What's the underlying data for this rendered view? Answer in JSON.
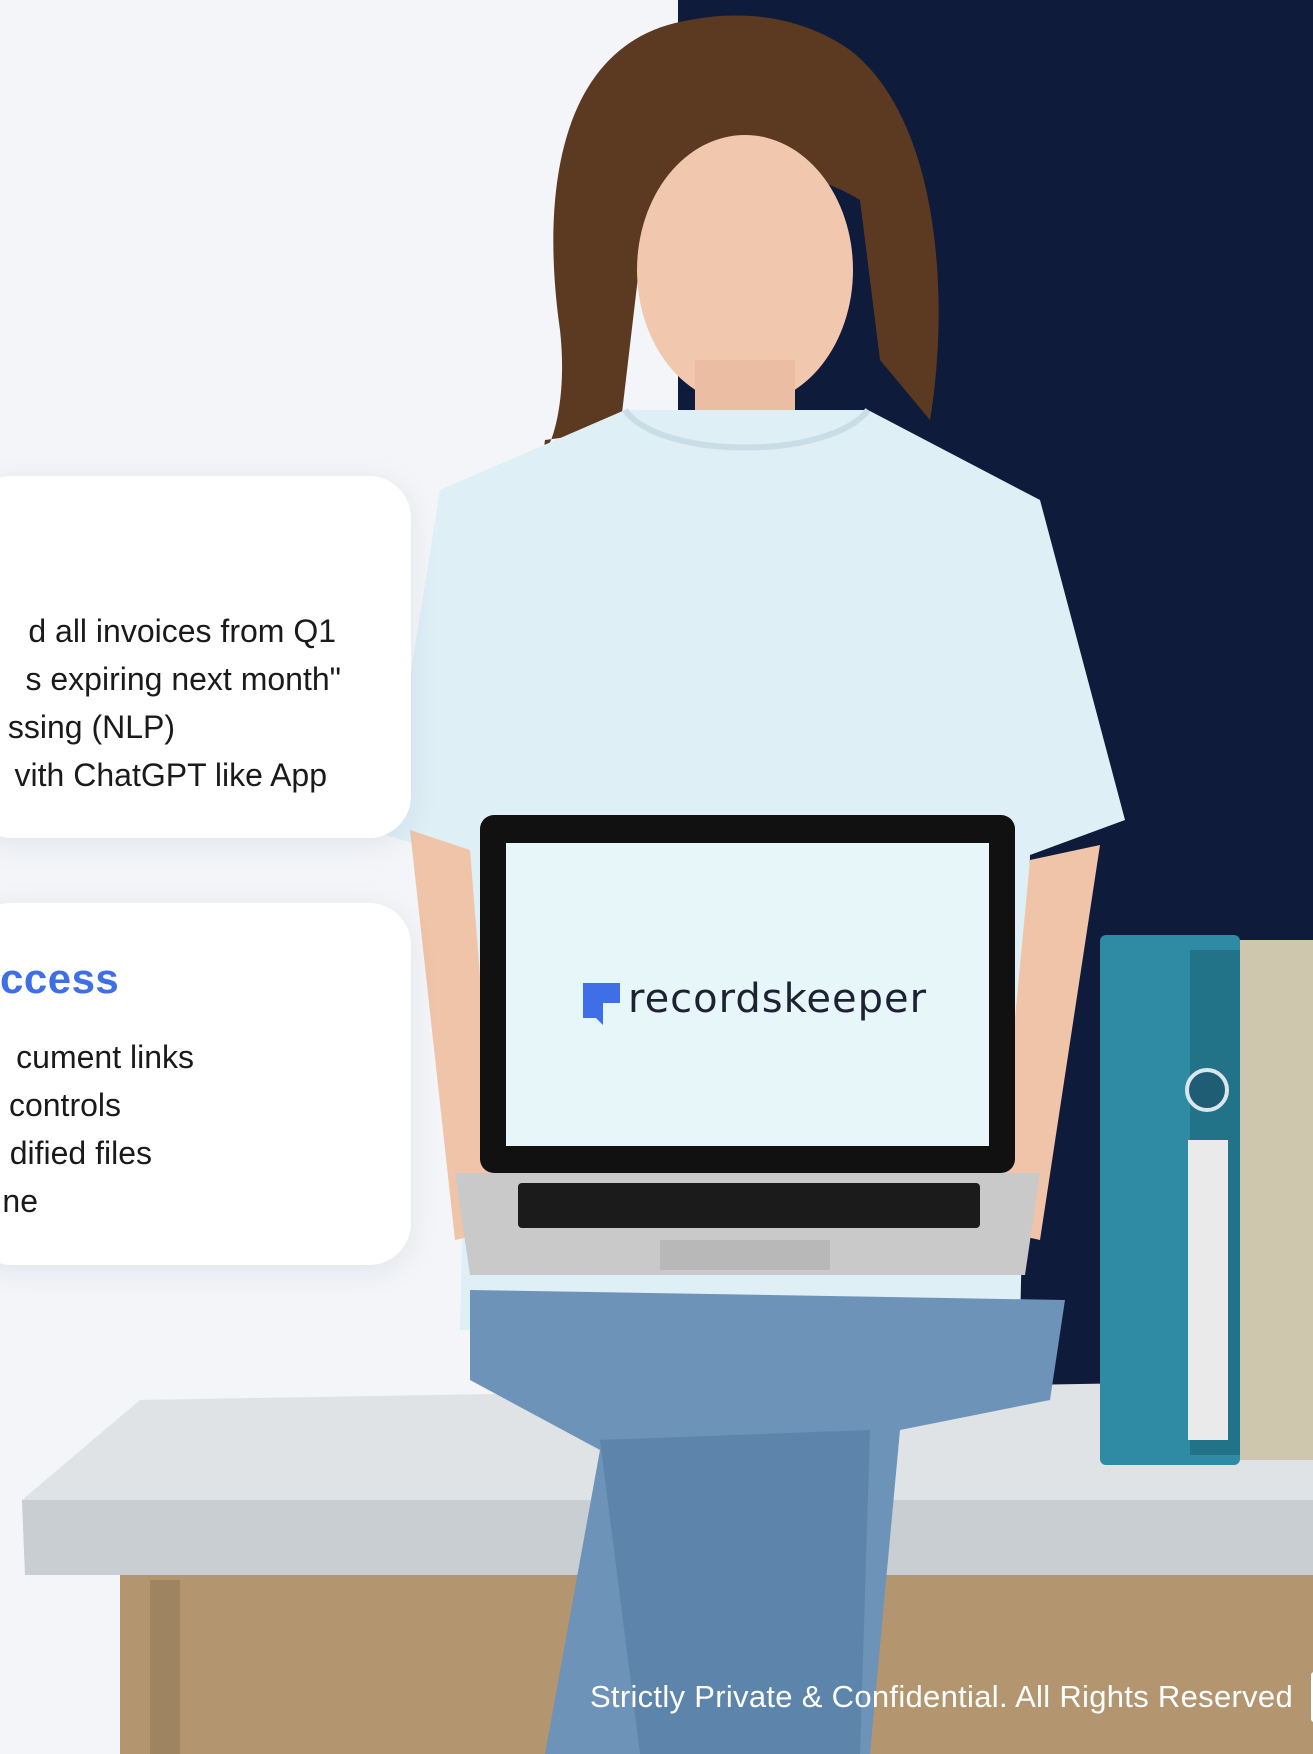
{
  "cards": [
    {
      "title": "",
      "items": [
        "d all invoices from Q1",
        "s expiring next month\"",
        "ssing (NLP)",
        "vith ChatGPT like App"
      ]
    },
    {
      "title": "ccess",
      "items": [
        "cument links",
        "controls",
        "dified files",
        "ne"
      ]
    }
  ],
  "laptop": {
    "brand": "recordskeeper"
  },
  "footer": {
    "text": "Strictly Private & Confidential. All Rights Reserved"
  },
  "colors": {
    "accent": "#3f6fe6",
    "dark_panel": "#0f1b3a",
    "page_bg": "#f3f5f8"
  }
}
